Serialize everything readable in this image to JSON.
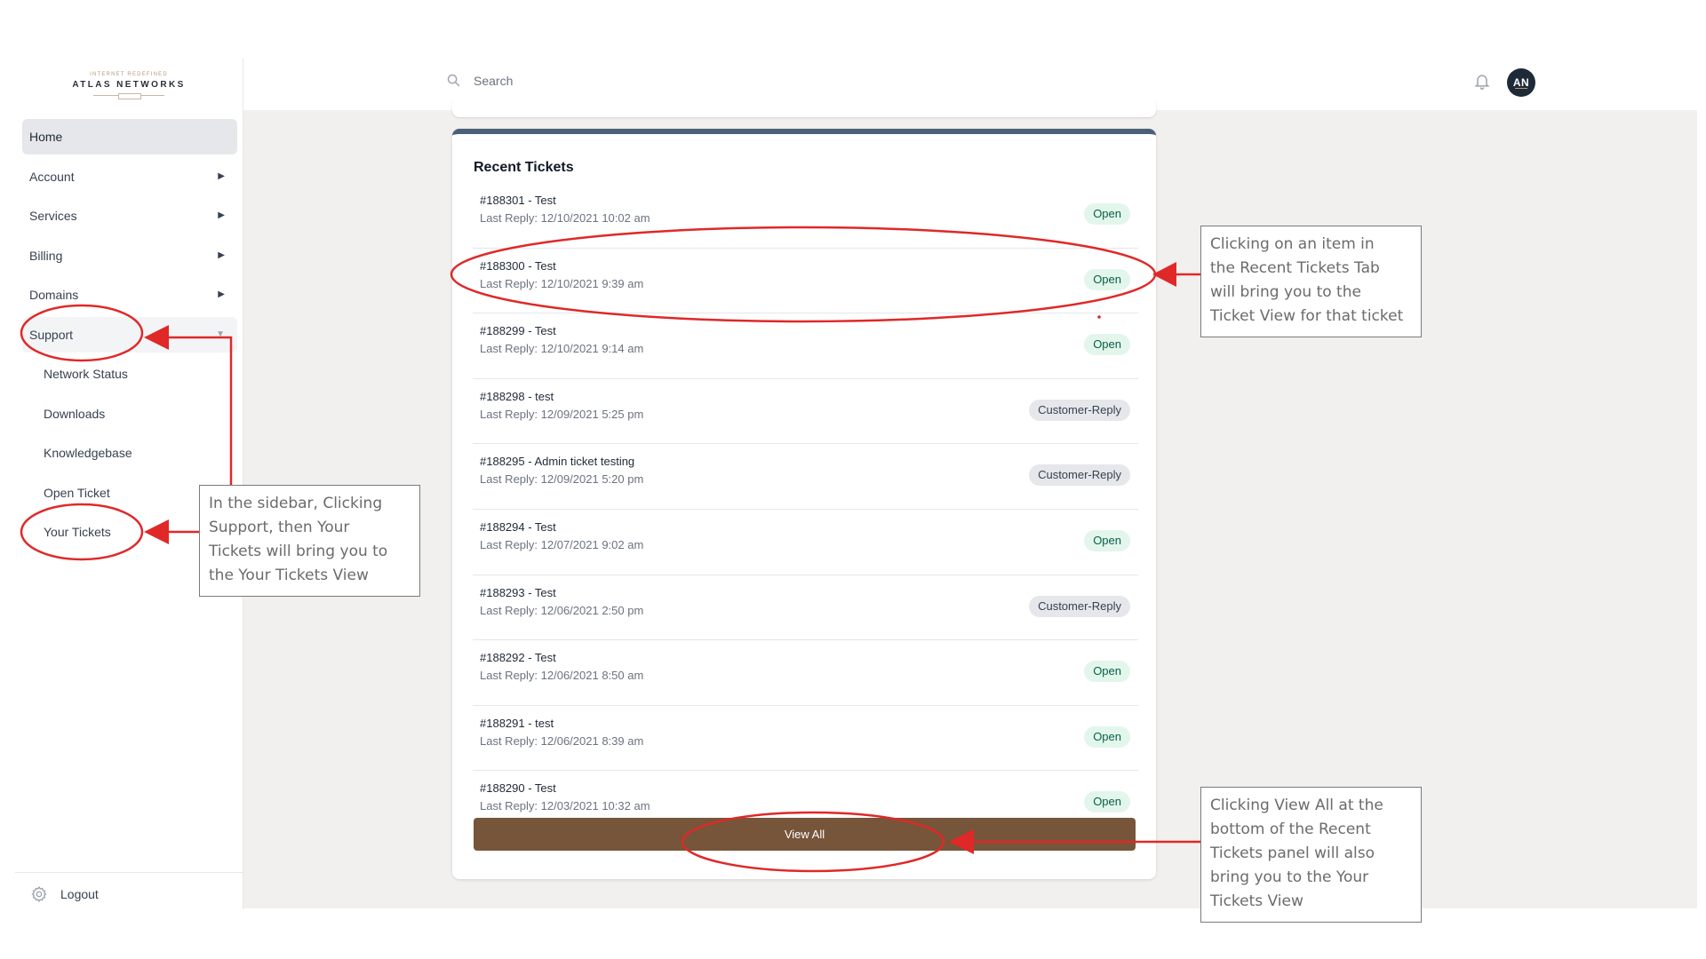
{
  "brand": {
    "tagline": "INTERNET REDEFINED",
    "name": "ATLAS NETWORKS"
  },
  "sidebar": {
    "items": [
      {
        "label": "Home",
        "active": true
      },
      {
        "label": "Account",
        "caret": "▶"
      },
      {
        "label": "Services",
        "caret": "▶"
      },
      {
        "label": "Billing",
        "caret": "▶"
      },
      {
        "label": "Domains",
        "caret": "▶"
      },
      {
        "label": "Support",
        "caret": "▼",
        "expanded": true
      }
    ],
    "support_children": [
      "Network Status",
      "Downloads",
      "Knowledgebase",
      "Open Ticket",
      "Your Tickets"
    ],
    "logout_label": "Logout",
    "logout_icon": "gear-icon"
  },
  "header": {
    "search_placeholder": "Search",
    "search_icon": "search-icon",
    "notifications_icon": "bell-icon",
    "avatar_initials": "AN"
  },
  "recent_tickets": {
    "title": "Recent Tickets",
    "items": [
      {
        "subject": "#188301 - Test",
        "last_reply": "Last Reply: 12/10/2021 10:02 am",
        "status": "Open"
      },
      {
        "subject": "#188300 - Test",
        "last_reply": "Last Reply: 12/10/2021 9:39 am",
        "status": "Open"
      },
      {
        "subject": "#188299 - Test",
        "last_reply": "Last Reply: 12/10/2021 9:14 am",
        "status": "Open"
      },
      {
        "subject": "#188298 - test",
        "last_reply": "Last Reply: 12/09/2021 5:25 pm",
        "status": "Customer-Reply"
      },
      {
        "subject": "#188295 - Admin ticket testing",
        "last_reply": "Last Reply: 12/09/2021 5:20 pm",
        "status": "Customer-Reply"
      },
      {
        "subject": "#188294 - Test",
        "last_reply": "Last Reply: 12/07/2021 9:02 am",
        "status": "Open"
      },
      {
        "subject": "#188293 - Test",
        "last_reply": "Last Reply: 12/06/2021 2:50 pm",
        "status": "Customer-Reply"
      },
      {
        "subject": "#188292 - Test",
        "last_reply": "Last Reply: 12/06/2021 8:50 am",
        "status": "Open"
      },
      {
        "subject": "#188291 - test",
        "last_reply": "Last Reply: 12/06/2021 8:39 am",
        "status": "Open"
      },
      {
        "subject": "#188290 - Test",
        "last_reply": "Last Reply: 12/03/2021 10:32 am",
        "status": "Open"
      }
    ],
    "view_all_label": "View All"
  },
  "annotations": {
    "sidebar_note": [
      "In the sidebar, Clicking",
      "Support, then Your",
      "Tickets will bring you to",
      "the Your Tickets View"
    ],
    "ticket_item_note": [
      "Clicking on an item in",
      "the Recent Tickets Tab",
      "will bring you to the",
      "Ticket View for that ticket"
    ],
    "view_all_note": [
      "Clicking View All at the",
      "bottom of the Recent",
      "Tickets panel will also",
      "bring you to the Your",
      "Tickets View"
    ]
  },
  "colors": {
    "accent_brown": "#76553a",
    "card_header_blue": "#4a6078",
    "annotation_red": "#e02828",
    "open_badge_bg": "#e3f6ec",
    "customer_reply_badge_bg": "#e5e7eb"
  }
}
